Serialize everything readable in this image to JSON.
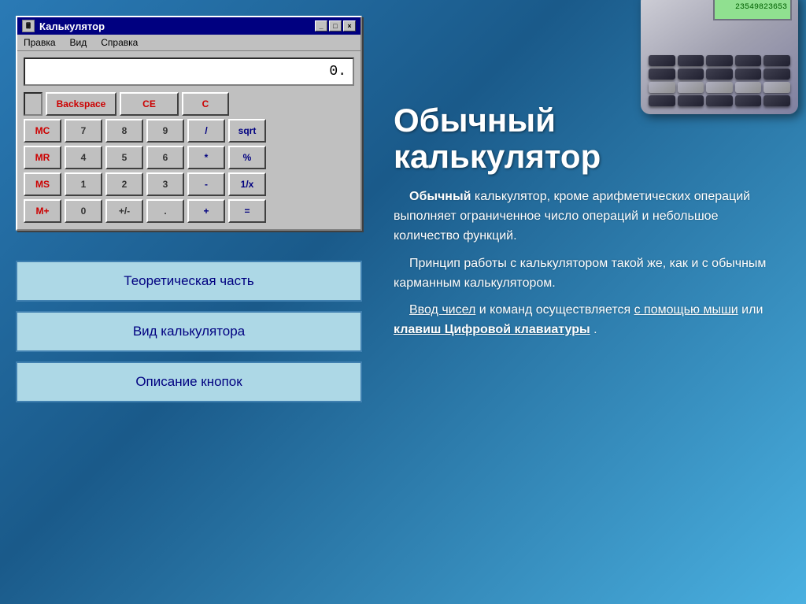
{
  "window": {
    "title": "Калькулятор",
    "menu": [
      "Правка",
      "Вид",
      "Справка"
    ],
    "titlebar_buttons": [
      "_",
      "□",
      "×"
    ]
  },
  "calculator": {
    "display": "0.",
    "rows": [
      {
        "id": "row0",
        "buttons": [
          {
            "label": "",
            "type": "checkbox",
            "class": "w-checkbox"
          },
          {
            "label": "Backspace",
            "type": "red",
            "class": "w-backspace"
          },
          {
            "label": "CE",
            "type": "red",
            "class": "w-ce"
          },
          {
            "label": "C",
            "type": "red",
            "class": "w-c"
          }
        ]
      },
      {
        "id": "row1",
        "buttons": [
          {
            "label": "MC",
            "type": "red",
            "class": "w-mem"
          },
          {
            "label": "7",
            "type": "gray",
            "class": "w-digit"
          },
          {
            "label": "8",
            "type": "gray",
            "class": "w-digit"
          },
          {
            "label": "9",
            "type": "gray",
            "class": "w-digit"
          },
          {
            "label": "/",
            "type": "blue",
            "class": "w-op"
          },
          {
            "label": "sqrt",
            "type": "blue",
            "class": "w-spec"
          }
        ]
      },
      {
        "id": "row2",
        "buttons": [
          {
            "label": "MR",
            "type": "red",
            "class": "w-mem"
          },
          {
            "label": "4",
            "type": "gray",
            "class": "w-digit"
          },
          {
            "label": "5",
            "type": "gray",
            "class": "w-digit"
          },
          {
            "label": "6",
            "type": "gray",
            "class": "w-digit"
          },
          {
            "label": "*",
            "type": "blue",
            "class": "w-op"
          },
          {
            "label": "%",
            "type": "blue",
            "class": "w-spec"
          }
        ]
      },
      {
        "id": "row3",
        "buttons": [
          {
            "label": "MS",
            "type": "red",
            "class": "w-mem"
          },
          {
            "label": "1",
            "type": "gray",
            "class": "w-digit"
          },
          {
            "label": "2",
            "type": "gray",
            "class": "w-digit"
          },
          {
            "label": "3",
            "type": "gray",
            "class": "w-digit"
          },
          {
            "label": "-",
            "type": "blue",
            "class": "w-op"
          },
          {
            "label": "1/x",
            "type": "blue",
            "class": "w-spec"
          }
        ]
      },
      {
        "id": "row4",
        "buttons": [
          {
            "label": "M+",
            "type": "red",
            "class": "w-mem"
          },
          {
            "label": "0",
            "type": "gray",
            "class": "w-zero"
          },
          {
            "label": "+/-",
            "type": "gray",
            "class": "w-plusminus"
          },
          {
            "label": ".",
            "type": "gray",
            "class": "w-dot"
          },
          {
            "label": "+",
            "type": "blue",
            "class": "w-plus"
          },
          {
            "label": "=",
            "type": "blue",
            "class": "w-eq"
          }
        ]
      }
    ]
  },
  "nav_buttons": [
    {
      "label": "Теоретическая часть",
      "id": "nav-theory"
    },
    {
      "label": "Вид калькулятора",
      "id": "nav-view"
    },
    {
      "label": "Описание кнопок",
      "id": "nav-buttons"
    }
  ],
  "right": {
    "title_line1": "Обычный",
    "title_line2": "калькулятор",
    "paragraphs": [
      {
        "parts": [
          {
            "text": "Обычный ",
            "bold": true,
            "underline": false
          },
          {
            "text": "калькулятор, кроме арифметических операций выполняет ограниченное число операций и небольшое количество функций.",
            "bold": false,
            "underline": false
          }
        ]
      },
      {
        "parts": [
          {
            "text": "Принцип работы с калькулятором такой же, как и с обычным карманным калькулятором.",
            "bold": false,
            "underline": false
          }
        ]
      },
      {
        "parts": [
          {
            "text": "Ввод чисел",
            "bold": false,
            "underline": true
          },
          {
            "text": " и команд осуществляется ",
            "bold": false,
            "underline": false
          },
          {
            "text": "с помощью мыши",
            "bold": false,
            "underline": true
          },
          {
            "text": " или ",
            "bold": false,
            "underline": false
          },
          {
            "text": "клавиш Цифровой клавиатуры",
            "bold": true,
            "underline": true
          },
          {
            "text": ".",
            "bold": false,
            "underline": false
          }
        ]
      }
    ]
  },
  "calc_image": {
    "screen_text": "23549823653",
    "button_rows": 4,
    "button_cols": 5
  }
}
